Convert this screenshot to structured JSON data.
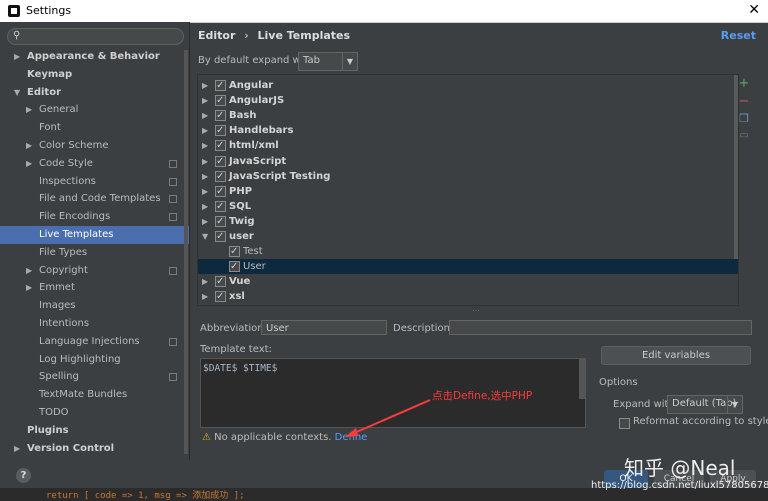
{
  "window": {
    "title": "Settings"
  },
  "sidebar": {
    "search_placeholder": "",
    "items": [
      {
        "label": "Appearance & Behavior",
        "level": 0,
        "arrow": "right",
        "bold": true
      },
      {
        "label": "Keymap",
        "level": 0,
        "arrow": "",
        "bold": true
      },
      {
        "label": "Editor",
        "level": 0,
        "arrow": "down",
        "bold": true
      },
      {
        "label": "General",
        "level": 1,
        "arrow": "right"
      },
      {
        "label": "Font",
        "level": 1,
        "arrow": ""
      },
      {
        "label": "Color Scheme",
        "level": 1,
        "arrow": "right"
      },
      {
        "label": "Code Style",
        "level": 1,
        "arrow": "right",
        "cfg": true
      },
      {
        "label": "Inspections",
        "level": 1,
        "arrow": "",
        "cfg": true
      },
      {
        "label": "File and Code Templates",
        "level": 1,
        "arrow": "",
        "cfg": true
      },
      {
        "label": "File Encodings",
        "level": 1,
        "arrow": "",
        "cfg": true
      },
      {
        "label": "Live Templates",
        "level": 1,
        "arrow": "",
        "selected": true
      },
      {
        "label": "File Types",
        "level": 1,
        "arrow": ""
      },
      {
        "label": "Copyright",
        "level": 1,
        "arrow": "right",
        "cfg": true
      },
      {
        "label": "Emmet",
        "level": 1,
        "arrow": "right"
      },
      {
        "label": "Images",
        "level": 1,
        "arrow": ""
      },
      {
        "label": "Intentions",
        "level": 1,
        "arrow": ""
      },
      {
        "label": "Language Injections",
        "level": 1,
        "arrow": "",
        "cfg": true
      },
      {
        "label": "Log Highlighting",
        "level": 1,
        "arrow": ""
      },
      {
        "label": "Spelling",
        "level": 1,
        "arrow": "",
        "cfg": true
      },
      {
        "label": "TextMate Bundles",
        "level": 1,
        "arrow": ""
      },
      {
        "label": "TODO",
        "level": 1,
        "arrow": ""
      },
      {
        "label": "Plugins",
        "level": 0,
        "arrow": "",
        "bold": true
      },
      {
        "label": "Version Control",
        "level": 0,
        "arrow": "right",
        "bold": true
      }
    ]
  },
  "main": {
    "breadcrumb_parent": "Editor",
    "breadcrumb_sep": "›",
    "breadcrumb_current": "Live Templates",
    "reset_label": "Reset",
    "expand_label": "By default expand with",
    "expand_value": "Tab",
    "templates": [
      {
        "name": "Angular",
        "level": 0,
        "arrow": "right",
        "bold": true
      },
      {
        "name": "AngularJS",
        "level": 0,
        "arrow": "right",
        "bold": true
      },
      {
        "name": "Bash",
        "level": 0,
        "arrow": "right",
        "bold": true
      },
      {
        "name": "Handlebars",
        "level": 0,
        "arrow": "right",
        "bold": true
      },
      {
        "name": "html/xml",
        "level": 0,
        "arrow": "right",
        "bold": true
      },
      {
        "name": "JavaScript",
        "level": 0,
        "arrow": "right",
        "bold": true
      },
      {
        "name": "JavaScript Testing",
        "level": 0,
        "arrow": "right",
        "bold": true
      },
      {
        "name": "PHP",
        "level": 0,
        "arrow": "right",
        "bold": true
      },
      {
        "name": "SQL",
        "level": 0,
        "arrow": "right",
        "bold": true
      },
      {
        "name": "Twig",
        "level": 0,
        "arrow": "right",
        "bold": true
      },
      {
        "name": "user",
        "level": 0,
        "arrow": "down",
        "bold": true
      },
      {
        "name": "Test",
        "level": 1,
        "arrow": ""
      },
      {
        "name": "User",
        "level": 1,
        "arrow": "",
        "selected": true
      },
      {
        "name": "Vue",
        "level": 0,
        "arrow": "right",
        "bold": true
      },
      {
        "name": "xsl",
        "level": 0,
        "arrow": "right",
        "bold": true
      }
    ],
    "abbreviation_label": "Abbreviation:",
    "abbreviation_value": "User",
    "description_label": "Description:",
    "description_value": "",
    "template_text_label": "Template text:",
    "template_text_value": "$DATE$ $TIME$",
    "edit_variables_label": "Edit variables",
    "options_label": "Options",
    "expand_with_label": "Expand with",
    "expand_with_value": "Default (Tab)",
    "reformat_label": "Reformat according to style",
    "warning_text": "No applicable contexts.",
    "define_link": "Define",
    "annotation": "点击Define,选中PHP"
  },
  "footer": {
    "ok_label": "OK",
    "cancel_label": "Cancel",
    "apply_label": "Apply",
    "code_strip": "return [ code => 1, msg => 添加成功 ];"
  },
  "watermark": {
    "brand": "知乎 @Neal",
    "url": "https://blog.csdn.net/liuxl57805678"
  },
  "colors": {
    "selection": "#4b6eaf",
    "link": "#589df6",
    "annotation": "#ff3b3b",
    "warning": "#e0b020"
  }
}
